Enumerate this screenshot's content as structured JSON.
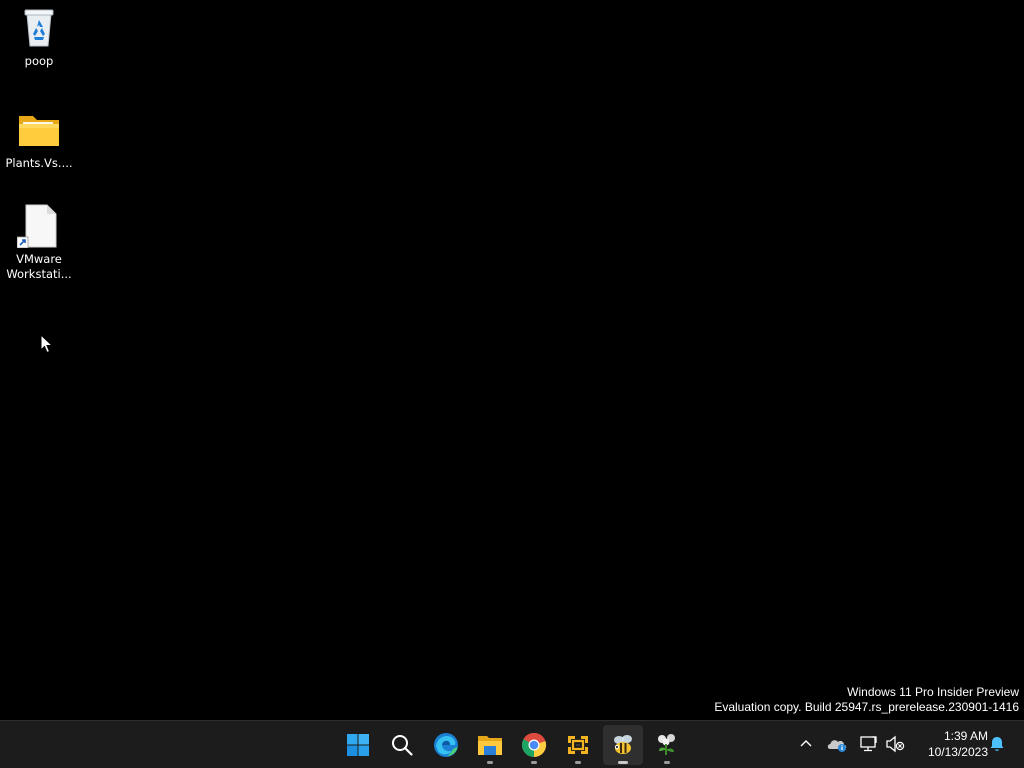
{
  "desktop": {
    "icons": [
      {
        "label": "poop",
        "icon": "recycle-bin-icon"
      },
      {
        "label": "Plants.Vs....",
        "icon": "folder-icon"
      },
      {
        "label": "VMware Workstati...",
        "icon": "shortcut-file-icon"
      }
    ],
    "background_color": "#000000"
  },
  "watermark": {
    "line1": "Windows 11 Pro Insider Preview",
    "line2": "Evaluation copy. Build 25947.rs_prerelease.230901-1416"
  },
  "taskbar": {
    "background_color": "#1c1c1c",
    "apps": [
      {
        "name": "Start",
        "icon": "windows-start-icon"
      },
      {
        "name": "Search",
        "icon": "search-icon"
      },
      {
        "name": "Microsoft Edge",
        "icon": "edge-icon"
      },
      {
        "name": "File Explorer",
        "icon": "file-explorer-icon",
        "running": true
      },
      {
        "name": "Google Chrome",
        "icon": "chrome-icon",
        "running": true
      },
      {
        "name": "VMware Workstation",
        "icon": "vmware-icon",
        "running": true
      },
      {
        "name": "Plants vs. Zombies",
        "icon": "pvz-bee-icon",
        "running": true,
        "active": true
      },
      {
        "name": "Plants vs. Zombies 2",
        "icon": "pvz-plant-icon",
        "running": true
      }
    ],
    "tray": {
      "icons": [
        "chevron-up-icon",
        "onedrive-icon",
        "network-icon",
        "volume-muted-icon",
        "notification-bell-icon"
      ],
      "time": "1:39 AM",
      "date": "10/13/2023"
    }
  }
}
